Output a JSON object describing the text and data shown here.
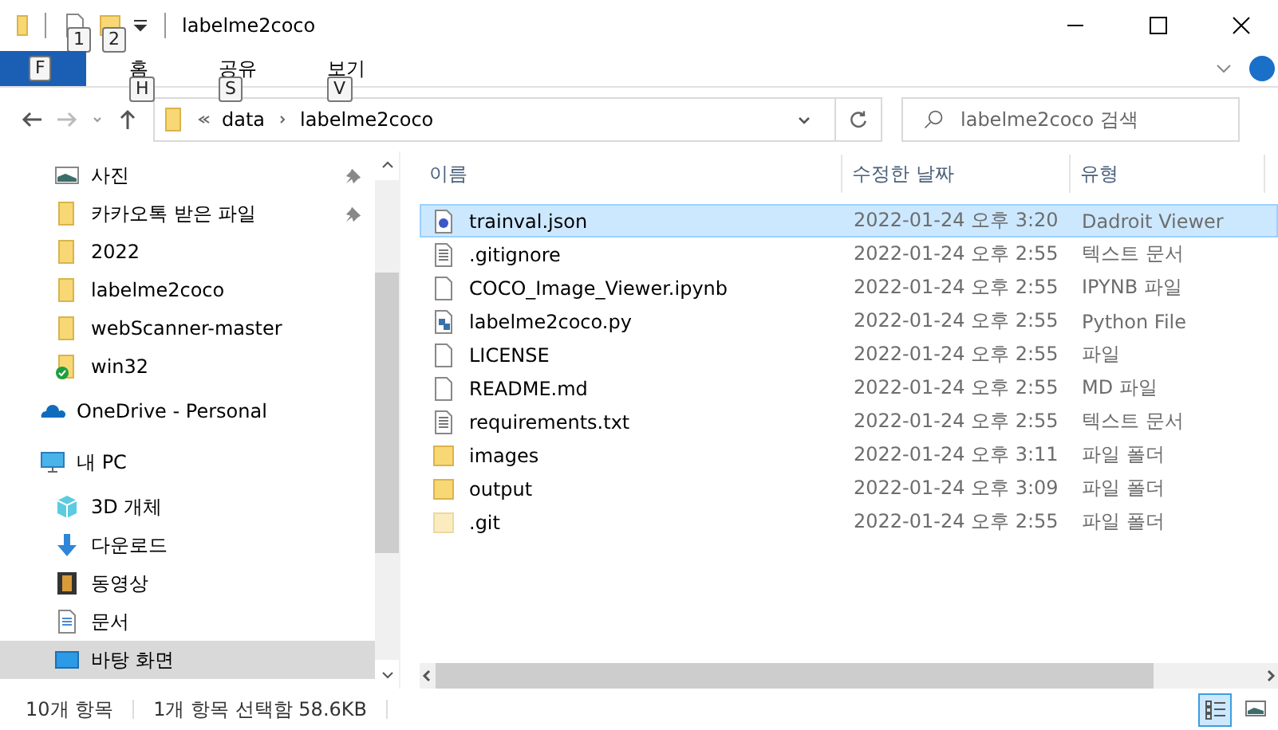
{
  "window": {
    "title": "labelme2coco",
    "quick_access_tips": [
      "1",
      "2"
    ]
  },
  "ribbon": {
    "tabs": [
      {
        "key_tip": "F",
        "selected": true
      },
      {
        "label": "홈",
        "key_tip": "H",
        "selected": false
      },
      {
        "label": "공유",
        "key_tip": "S",
        "selected": false
      },
      {
        "label": "보기",
        "key_tip": "V",
        "selected": false
      }
    ]
  },
  "address": {
    "path": [
      "data",
      "labelme2coco"
    ]
  },
  "search": {
    "placeholder": "labelme2coco 검색"
  },
  "sidebar": {
    "items": [
      {
        "label": "사진",
        "kind": "photo",
        "pinned": true,
        "selected": false
      },
      {
        "label": "카카오톡 받은 파일",
        "kind": "folder",
        "pinned": true,
        "selected": false
      },
      {
        "label": "2022",
        "kind": "folder",
        "pinned": false,
        "selected": false
      },
      {
        "label": "labelme2coco",
        "kind": "folder",
        "pinned": false,
        "selected": false
      },
      {
        "label": "webScanner-master",
        "kind": "folder",
        "pinned": false,
        "selected": false
      },
      {
        "label": "win32",
        "kind": "synced",
        "pinned": false,
        "selected": false
      },
      {
        "label": "OneDrive - Personal",
        "kind": "cloud",
        "pinned": false,
        "selected": false
      },
      {
        "label": "내 PC",
        "kind": "pc",
        "pinned": false,
        "selected": false,
        "children": [
          {
            "label": "3D 개체",
            "kind": "cube",
            "pinned": false,
            "selected": false
          },
          {
            "label": "다운로드",
            "kind": "download",
            "pinned": false,
            "selected": false
          },
          {
            "label": "동영상",
            "kind": "video",
            "pinned": false,
            "selected": false
          },
          {
            "label": "문서",
            "kind": "doc",
            "pinned": false,
            "selected": false
          },
          {
            "label": "바탕 화면",
            "kind": "desktop",
            "pinned": false,
            "selected": true
          }
        ]
      }
    ]
  },
  "table": {
    "columns": [
      "이름",
      "수정한 날짜",
      "유형"
    ],
    "rows": [
      {
        "name": "trainval.json",
        "date": "2022-01-24 오후 3:20",
        "type": "Dadroit Viewer",
        "kind": "json",
        "selected": true
      },
      {
        "name": ".gitignore",
        "date": "2022-01-24 오후 2:55",
        "type": "텍스트 문서",
        "kind": "text",
        "selected": false
      },
      {
        "name": "COCO_Image_Viewer.ipynb",
        "date": "2022-01-24 오후 2:55",
        "type": "IPYNB 파일",
        "kind": "blank",
        "selected": false
      },
      {
        "name": "labelme2coco.py",
        "date": "2022-01-24 오후 2:55",
        "type": "Python File",
        "kind": "python",
        "selected": false
      },
      {
        "name": "LICENSE",
        "date": "2022-01-24 오후 2:55",
        "type": "파일",
        "kind": "blank",
        "selected": false
      },
      {
        "name": "README.md",
        "date": "2022-01-24 오후 2:55",
        "type": "MD 파일",
        "kind": "blank",
        "selected": false
      },
      {
        "name": "requirements.txt",
        "date": "2022-01-24 오후 2:55",
        "type": "텍스트 문서",
        "kind": "text",
        "selected": false
      },
      {
        "name": "images",
        "date": "2022-01-24 오후 3:11",
        "type": "파일 폴더",
        "kind": "folder",
        "selected": false
      },
      {
        "name": "output",
        "date": "2022-01-24 오후 3:09",
        "type": "파일 폴더",
        "kind": "folder",
        "selected": false
      },
      {
        "name": ".git",
        "date": "2022-01-24 오후 2:55",
        "type": "파일 폴더",
        "kind": "hidden_folder",
        "selected": false
      }
    ]
  },
  "status_bar": {
    "count": "10개 항목",
    "selection": "1개 항목 선택함 58.6KB"
  }
}
